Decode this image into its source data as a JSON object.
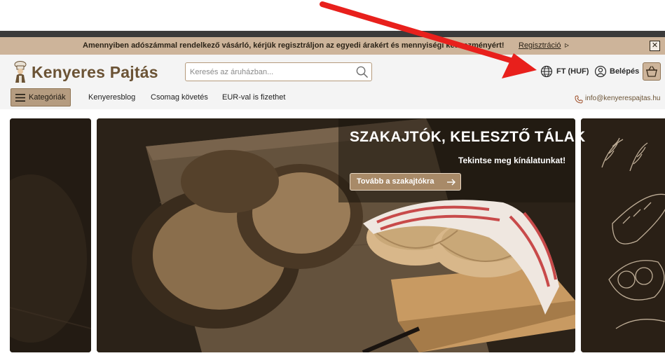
{
  "announcement": {
    "text": "Amennyiben adószámmal rendelkező vásárló, kérjük regisztráljon az egyedi árakért és mennyiségi kedvezményért!",
    "link_label": "Regisztráció",
    "link_arrow": "▹",
    "close_label": "✕"
  },
  "header": {
    "logo_text": "Kenyeres Pajtás",
    "search": {
      "placeholder": "Keresés az áruházban...",
      "value": ""
    },
    "currency_label": "FT (HUF)",
    "login_label": "Belépés"
  },
  "nav": {
    "categories_label": "Kategóriák",
    "links": [
      "Kenyeresblog",
      "Csomag követés",
      "EUR-val is fizethet"
    ],
    "contact_email": "info@kenyerespajtas.hu"
  },
  "hero": {
    "title": "SZAKAJTÓK, KELESZTŐ TÁLAK",
    "subtitle": "Tekintse meg kínálatunkat!",
    "button_label": "Tovább a szakajtókra"
  },
  "colors": {
    "brand_brown": "#6b5335",
    "announce_bg": "#cdb49a",
    "annotation_arrow": "#e8201c"
  }
}
